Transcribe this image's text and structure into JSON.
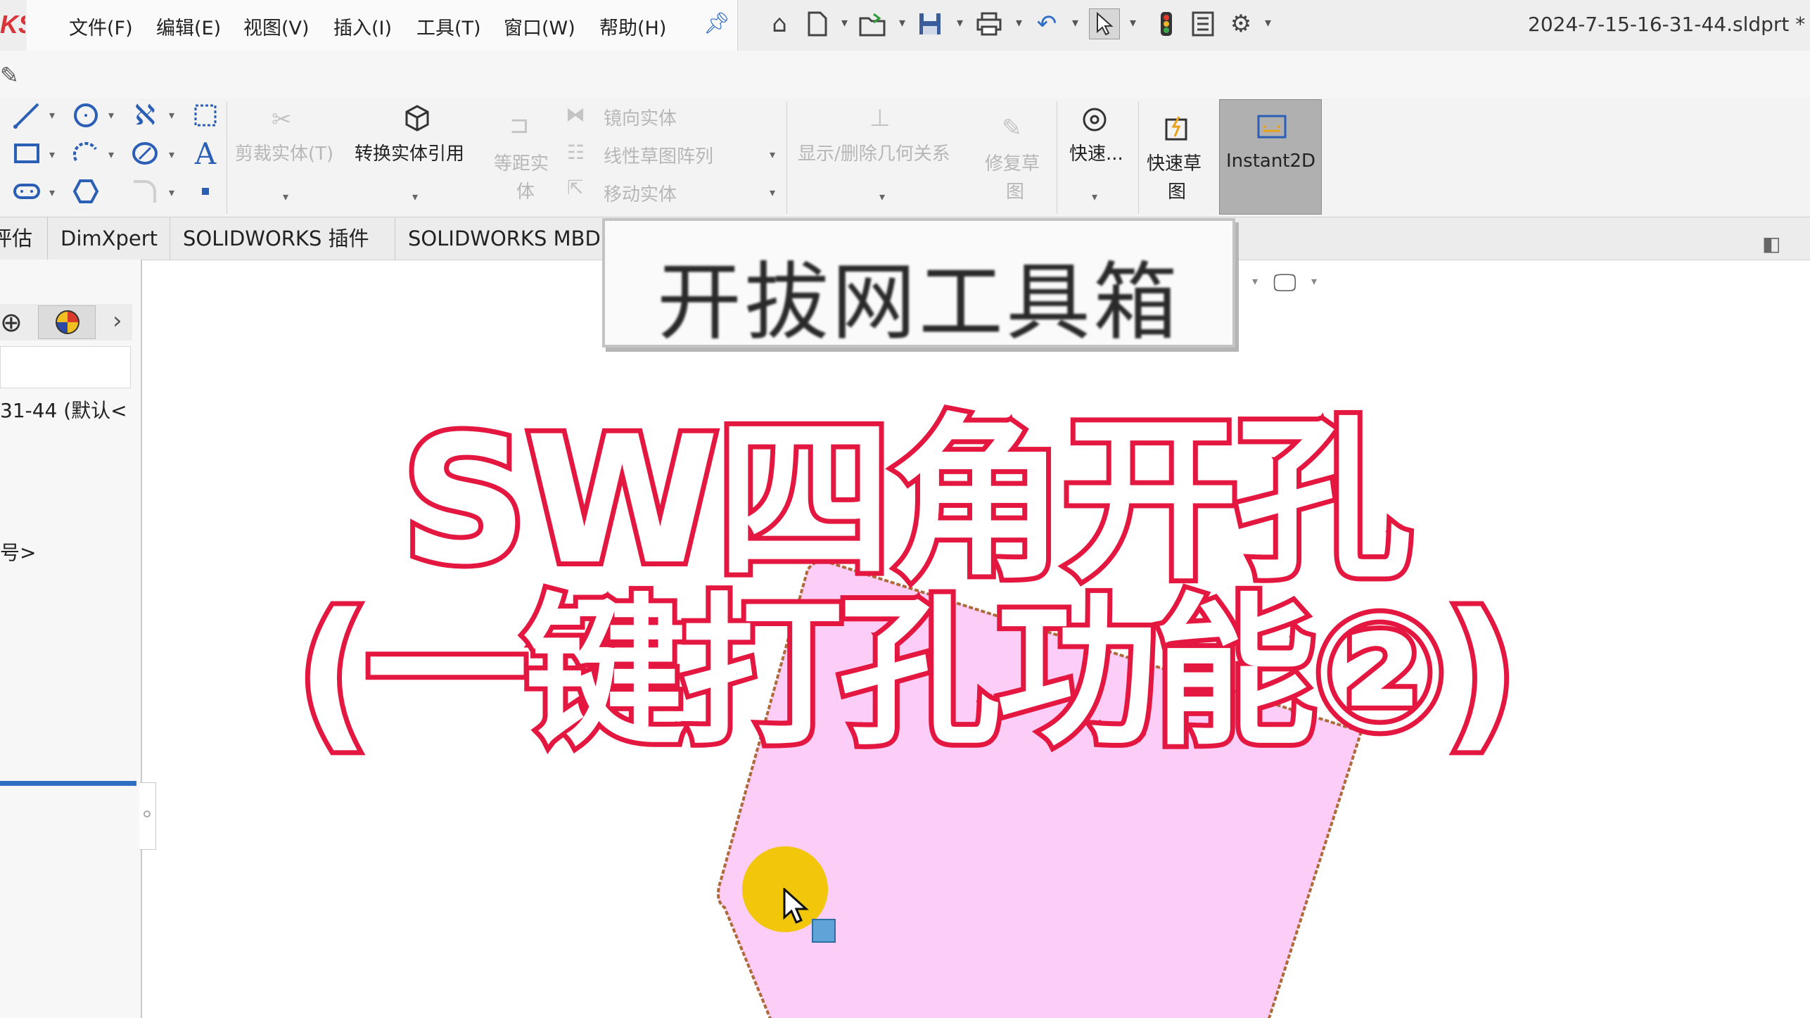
{
  "app": {
    "logo_text": "KS",
    "file_name": "2024-7-15-16-31-44.sldprt *"
  },
  "menu": {
    "items": [
      "文件(F)",
      "编辑(E)",
      "视图(V)",
      "插入(I)",
      "工具(T)",
      "窗口(W)",
      "帮助(H)"
    ]
  },
  "quick_access": {
    "icons": [
      "home-icon",
      "new-document-icon",
      "open-icon",
      "save-icon",
      "print-icon",
      "undo-icon",
      "select-icon",
      "traffic-light-icon",
      "file-properties-icon",
      "options-gear-icon"
    ]
  },
  "ribbon": {
    "trim": "剪裁实体(T)",
    "convert": "转换实体引用",
    "offset_line1": "等距实",
    "offset_line2": "体",
    "mirror": "镜向实体",
    "linear_pattern": "线性草图阵列",
    "move": "移动实体",
    "show_relations": "显示/删除几何关系",
    "repair_line1": "修复草",
    "repair_line2": "图",
    "quick_snaps": "快速...",
    "rapid_line1": "快速草",
    "rapid_line2": "图",
    "instant2d": "Instant2D"
  },
  "tabs": [
    "评估",
    "DimXpert",
    "SOLIDWORKS 插件",
    "SOLIDWORKS MBD"
  ],
  "tree": {
    "root_label": "31-44 (默认<",
    "item2_label": "号>"
  },
  "overlay": {
    "toolbox_title": "开拔网工具箱",
    "title_line1": "SW四角开孔",
    "title_line2": "(一键打孔功能②)"
  },
  "colors": {
    "title_stroke": "#e3173f",
    "part_fill": "#fccdf7",
    "part_edge": "#b06a3a",
    "cursor_dot": "#f2c60a",
    "accent_blue": "#2e6fc4"
  }
}
